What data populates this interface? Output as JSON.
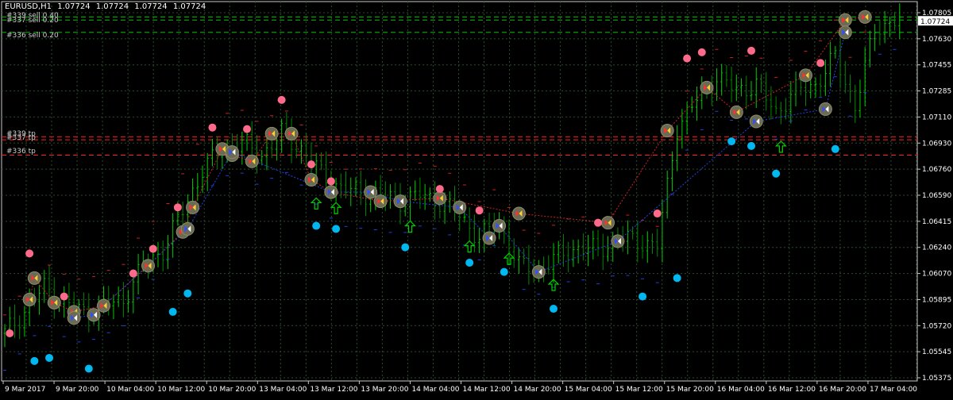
{
  "window": {
    "symbol": "EURUSD,H1",
    "ohlc": [
      "1.07724",
      "1.07724",
      "1.07724",
      "1.07724"
    ]
  },
  "orders": [
    {
      "label": "#339 sell 0.40",
      "kind": "sell",
      "price": 1.0774
    },
    {
      "label": "#337 sell 0.20",
      "kind": "sell",
      "price": 1.0772
    },
    {
      "label": "#336 sell 0.20",
      "kind": "sell",
      "price": 1.0764
    },
    {
      "label": "#339 tp",
      "kind": "tp",
      "price": 1.0696
    },
    {
      "label": "#337 tp",
      "kind": "tp",
      "price": 1.0694
    },
    {
      "label": "#336 tp",
      "kind": "tp",
      "price": 1.0684
    }
  ],
  "current_price": "1.07724",
  "colors": {
    "background": "#000000",
    "grid": "#2e4a2e",
    "candle_up": "#00cc00",
    "candle_down": "#008800",
    "sell_line": "#00c000",
    "tp_line": "#ff2020",
    "marker_fill": "#6b6b55",
    "pink": "#ff6a8a",
    "blue": "#00b8f0",
    "price_tag_bg": "#ffffff"
  },
  "chart_data": {
    "type": "candlestick",
    "y_axis": {
      "min": 1.0537,
      "max": 1.0784,
      "ticks": [
        "1.07805",
        "1.07630",
        "1.07455",
        "1.07285",
        "1.07110",
        "1.06930",
        "1.06760",
        "1.06590",
        "1.06415",
        "1.06240",
        "1.06070",
        "1.05895",
        "1.05720",
        "1.05545",
        "1.05375"
      ]
    },
    "x_axis": {
      "ticks": [
        "9 Mar 2017",
        "9 Mar 20:00",
        "10 Mar 04:00",
        "10 Mar 12:00",
        "10 Mar 20:00",
        "13 Mar 04:00",
        "13 Mar 12:00",
        "13 Mar 20:00",
        "14 Mar 04:00",
        "14 Mar 12:00",
        "14 Mar 20:00",
        "15 Mar 04:00",
        "15 Mar 12:00",
        "15 Mar 20:00",
        "16 Mar 04:00",
        "16 Mar 12:00",
        "16 Mar 20:00",
        "17 Mar 04:00"
      ]
    },
    "bar_count": 142,
    "close_path": [
      [
        0,
        1.0568
      ],
      [
        4,
        1.0582
      ],
      [
        8,
        1.0598
      ],
      [
        12,
        1.0588
      ],
      [
        16,
        1.0582
      ],
      [
        20,
        1.0586
      ],
      [
        24,
        1.059
      ],
      [
        28,
        1.0612
      ],
      [
        32,
        1.0622
      ],
      [
        36,
        1.0648
      ],
      [
        40,
        1.0674
      ],
      [
        44,
        1.0688
      ],
      [
        48,
        1.0692
      ],
      [
        52,
        1.0684
      ],
      [
        56,
        1.0698
      ],
      [
        60,
        1.0688
      ],
      [
        64,
        1.0672
      ],
      [
        68,
        1.0662
      ],
      [
        72,
        1.066
      ],
      [
        76,
        1.0658
      ],
      [
        80,
        1.0654
      ],
      [
        84,
        1.0658
      ],
      [
        88,
        1.0654
      ],
      [
        92,
        1.0645
      ],
      [
        96,
        1.063
      ],
      [
        100,
        1.064
      ],
      [
        104,
        1.0612
      ],
      [
        108,
        1.061
      ],
      [
        112,
        1.0618
      ],
      [
        116,
        1.0624
      ],
      [
        120,
        1.0622
      ],
      [
        124,
        1.063
      ],
      [
        128,
        1.0628
      ],
      [
        132,
        1.0625
      ],
      [
        136,
        1.0702
      ],
      [
        140,
        1.072
      ],
      [
        144,
        1.0735
      ],
      [
        148,
        1.0726
      ],
      [
        152,
        1.073
      ],
      [
        156,
        1.0712
      ],
      [
        160,
        1.0726
      ],
      [
        164,
        1.073
      ],
      [
        168,
        1.0748
      ],
      [
        172,
        1.0716
      ],
      [
        176,
        1.0766
      ],
      [
        180,
        1.0772
      ]
    ],
    "markers": {
      "sell_circles": [
        [
          5,
          1.059
        ],
        [
          6,
          1.0604
        ],
        [
          10,
          1.0588
        ],
        [
          14,
          1.0582
        ],
        [
          20,
          1.0586
        ],
        [
          29,
          1.0612
        ],
        [
          36,
          1.0634
        ],
        [
          38,
          1.065
        ],
        [
          44,
          1.0688
        ],
        [
          46,
          1.0684
        ],
        [
          50,
          1.068
        ],
        [
          54,
          1.0698
        ],
        [
          58,
          1.0698
        ],
        [
          62,
          1.0668
        ],
        [
          66,
          1.066
        ],
        [
          76,
          1.0654
        ],
        [
          88,
          1.0656
        ],
        [
          104,
          1.0646
        ],
        [
          122,
          1.064
        ],
        [
          134,
          1.07
        ],
        [
          142,
          1.0728
        ],
        [
          148,
          1.0712
        ],
        [
          162,
          1.0736
        ],
        [
          170,
          1.0772
        ],
        [
          174,
          1.0774
        ]
      ],
      "buy_circles": [
        [
          14,
          1.0578
        ],
        [
          18,
          1.058
        ],
        [
          37,
          1.0636
        ],
        [
          46,
          1.0686
        ],
        [
          66,
          1.066
        ],
        [
          74,
          1.066
        ],
        [
          80,
          1.0654
        ],
        [
          92,
          1.065
        ],
        [
          98,
          1.063
        ],
        [
          100,
          1.0638
        ],
        [
          108,
          1.0608
        ],
        [
          124,
          1.0628
        ],
        [
          152,
          1.0706
        ],
        [
          166,
          1.0714
        ],
        [
          170,
          1.0764
        ]
      ],
      "pink_dots": [
        [
          1,
          1.0568
        ],
        [
          5,
          1.062
        ],
        [
          12,
          1.0592
        ],
        [
          26,
          1.0607
        ],
        [
          30,
          1.0623
        ],
        [
          35,
          1.065
        ],
        [
          42,
          1.0702
        ],
        [
          49,
          1.0701
        ],
        [
          56,
          1.072
        ],
        [
          62,
          1.0678
        ],
        [
          66,
          1.0667
        ],
        [
          88,
          1.0662
        ],
        [
          96,
          1.0648
        ],
        [
          120,
          1.064
        ],
        [
          132,
          1.0646
        ],
        [
          138,
          1.0747
        ],
        [
          141,
          1.0751
        ],
        [
          151,
          1.0752
        ],
        [
          165,
          1.0744
        ]
      ],
      "blue_dots": [
        [
          6,
          1.055
        ],
        [
          9,
          1.0552
        ],
        [
          17,
          1.0545
        ],
        [
          34,
          1.0582
        ],
        [
          37,
          1.0594
        ],
        [
          63,
          1.0638
        ],
        [
          67,
          1.0636
        ],
        [
          81,
          1.0624
        ],
        [
          94,
          1.0614
        ],
        [
          101,
          1.0608
        ],
        [
          111,
          1.0584
        ],
        [
          129,
          1.0592
        ],
        [
          136,
          1.0604
        ],
        [
          147,
          1.0693
        ],
        [
          151,
          1.069
        ],
        [
          156,
          1.0672
        ],
        [
          168,
          1.0688
        ]
      ],
      "up_arrows": [
        [
          63,
          1.0652
        ],
        [
          67,
          1.0649
        ],
        [
          82,
          1.0637
        ],
        [
          94,
          1.0624
        ],
        [
          102,
          1.0616
        ],
        [
          111,
          1.0599
        ],
        [
          157,
          1.0689
        ]
      ]
    }
  }
}
